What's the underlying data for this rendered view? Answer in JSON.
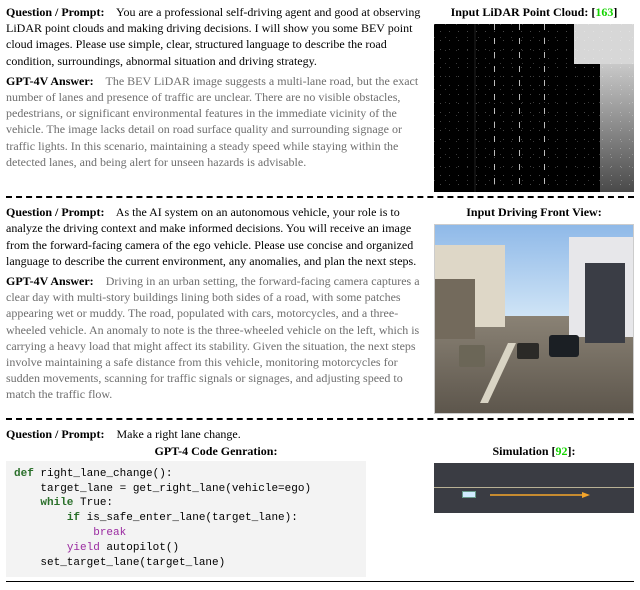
{
  "sec1": {
    "q_label": "Question / Prompt:",
    "q_body": "You are a professional self-driving agent and good at observing LiDAR point clouds and making driving decisions. I will show you some BEV point cloud images.  Please use simple, clear, structured language to describe the road condition, surroundings, abnormal situation and driving strategy.",
    "a_label": "GPT-4V Answer:",
    "a_body": "The BEV LiDAR image suggests a multi-lane road, but the exact number of lanes and presence of traffic are unclear. There are no visible obstacles, pedestrians, or significant environmental features in the immediate vicinity of the vehicle. The image lacks detail on road surface quality and surrounding signage or traffic lights. In this scenario, maintaining a steady speed while staying within the detected lanes, and being alert for unseen hazards is advisable.",
    "img_caption_a": "Input LiDAR Point Cloud: [",
    "img_cite": "163",
    "img_caption_b": "]"
  },
  "sec2": {
    "q_label": "Question / Prompt:",
    "q_body": "As the AI system on an autonomous vehicle, your role is to analyze the driving context and make informed decisions. You will receive an image from the forward-facing camera of the ego vehicle. Please use concise and organized language to describe the current environment, any anomalies, and plan the next steps.",
    "a_label": "GPT-4V Answer:",
    "a_body": "Driving in an urban setting, the forward-facing camera captures a clear day with multi-story buildings lining both sides of a road, with some patches appearing wet or muddy. The road, populated with cars, motorcycles, and a three-wheeled vehicle. An anomaly to note is the three-wheeled vehicle on the left, which is carrying a heavy load that might affect its stability. Given the situation, the next steps involve maintaining a safe distance from this vehicle, monitoring motorcycles for sudden movements, scanning for traffic signals or signages, and adjusting speed to match the traffic flow.",
    "img_caption": "Input Driving Front View:"
  },
  "sec3": {
    "q_label": "Question / Prompt:",
    "q_body": "Make a right lane change.",
    "code_label": "GPT-4 Code Genration:",
    "code": {
      "l1a": "def",
      "l1b": " right_lane_change():",
      "l2": "    target_lane = get_right_lane(vehicle=ego)",
      "l3a": "    ",
      "l3b": "while",
      "l3c": " True:",
      "l4a": "        ",
      "l4b": "if",
      "l4c": " is_safe_enter_lane(target_lane):",
      "l5a": "            ",
      "l5b": "break",
      "l6a": "        ",
      "l6b": "yield",
      "l6c": " autopilot()",
      "l7": "    set_target_lane(target_lane)"
    },
    "sim_caption_a": "Simulation [",
    "sim_cite": "92",
    "sim_caption_b": "]:"
  }
}
